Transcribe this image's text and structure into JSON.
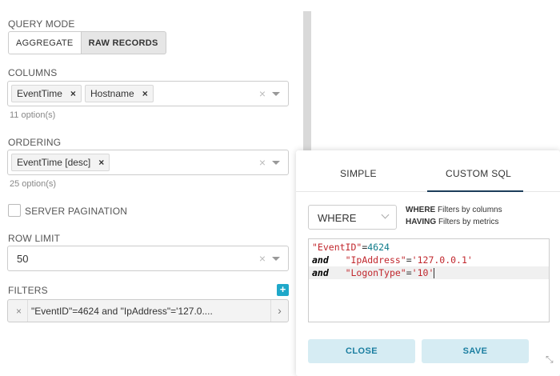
{
  "query_mode": {
    "label": "QUERY MODE",
    "options": [
      "AGGREGATE",
      "RAW RECORDS"
    ],
    "active": "RAW RECORDS"
  },
  "columns": {
    "label": "COLUMNS",
    "tags": [
      "EventTime",
      "Hostname"
    ],
    "help": "11 option(s)"
  },
  "ordering": {
    "label": "ORDERING",
    "tags": [
      "EventTime [desc]"
    ],
    "help": "25 option(s)"
  },
  "server_pagination": {
    "label": "SERVER PAGINATION",
    "checked": false
  },
  "row_limit": {
    "label": "ROW LIMIT",
    "value": "50"
  },
  "filters": {
    "label": "FILTERS",
    "add_icon": "plus-icon",
    "items": [
      "\"EventID\"=4624 and \"IpAddress\"='127.0...."
    ]
  },
  "popover": {
    "tabs": [
      "SIMPLE",
      "CUSTOM SQL"
    ],
    "active_tab": "CUSTOM SQL",
    "clause": "WHERE",
    "hint": [
      {
        "keyword": "WHERE",
        "text": "Filters by columns"
      },
      {
        "keyword": "HAVING",
        "text": "Filters by metrics"
      }
    ],
    "sql": {
      "line1_col": "\"EventID\"",
      "line1_op": "=",
      "line1_num": "4624",
      "line2_kw": "and",
      "line2_col": "\"IpAddress\"",
      "line2_op": "=",
      "line2_val": "'127.0.0.1'",
      "line3_kw": "and",
      "line3_col": "\"LogonType\"",
      "line3_op": "=",
      "line3_val": "'10'"
    },
    "close_label": "CLOSE",
    "save_label": "SAVE"
  },
  "colors": {
    "accent": "#1fa8c9",
    "button_bg": "#d6ecf3",
    "button_text": "#1a7ea0",
    "tab_underline": "#1c3d5a"
  }
}
